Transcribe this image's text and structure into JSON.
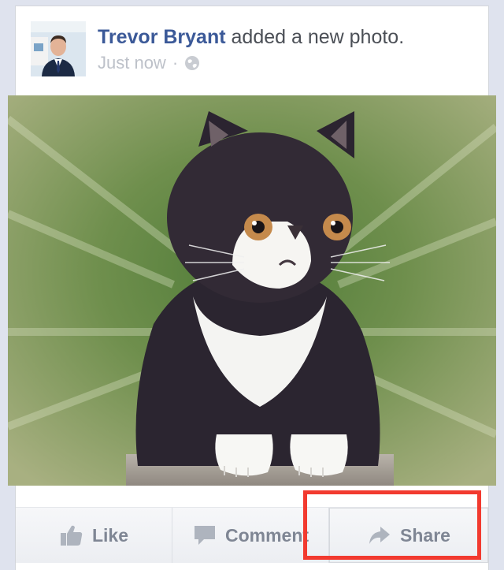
{
  "post": {
    "author_name": "Trevor Bryant",
    "action_text": "added a new photo.",
    "timestamp": "Just now",
    "separator": "·",
    "privacy_icon": "globe-icon",
    "photo_description": ""
  },
  "actions": {
    "like_label": "Like",
    "comment_label": "Comment",
    "share_label": "Share"
  },
  "colors": {
    "author_link": "#3b5998",
    "highlight": "#f23a2f",
    "action_text": "#7f8694"
  }
}
